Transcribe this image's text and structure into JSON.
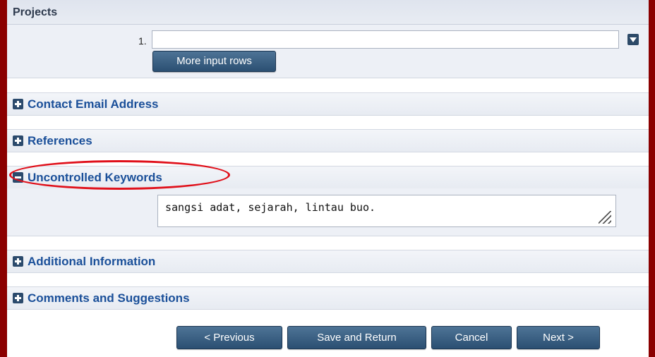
{
  "projects": {
    "title": "Projects",
    "row_number": "1.",
    "input_value": "",
    "more_rows_label": "More input rows"
  },
  "sections": {
    "contact_email": "Contact Email Address",
    "references": "References",
    "uncontrolled_keywords": "Uncontrolled Keywords",
    "additional_information": "Additional Information",
    "comments": "Comments and Suggestions"
  },
  "keywords": {
    "value": "sangsi adat, sejarah, lintau buo."
  },
  "navigation": {
    "previous": "< Previous",
    "save_return": "Save and Return",
    "cancel": "Cancel",
    "next": "Next >"
  },
  "colors": {
    "frame_border": "#8b0000",
    "section_label": "#1a4f99",
    "button": "#2b4f72",
    "highlight": "#e0101a"
  }
}
